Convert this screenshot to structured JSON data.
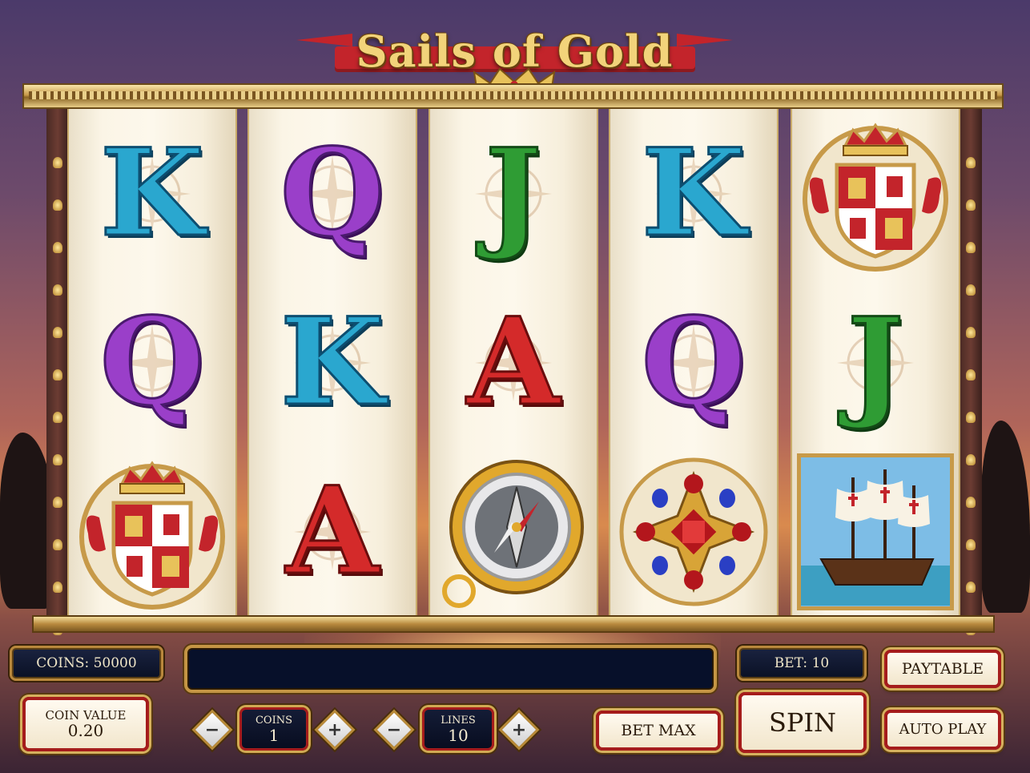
{
  "game": {
    "title": "Sails of Gold"
  },
  "reels": [
    [
      "K",
      "Q",
      "crest"
    ],
    [
      "Q",
      "K",
      "A"
    ],
    [
      "J",
      "A",
      "compass"
    ],
    [
      "K",
      "Q",
      "jewel"
    ],
    [
      "crest",
      "J",
      "ship"
    ]
  ],
  "symbols": {
    "crest": "coat-of-arms-icon",
    "compass": "pocket-compass-icon",
    "jewel": "ruby-jewel-icon",
    "ship": "galleon-ship-icon"
  },
  "panel": {
    "coins_label": "COINS: 50000",
    "message": "",
    "bet_label": "BET: 10",
    "paytable_label": "PAYTABLE",
    "coin_value_label": "COIN VALUE",
    "coin_value": "0.20",
    "coins_stepper_label": "COINS",
    "coins_value": "1",
    "lines_label": "LINES",
    "lines_value": "10",
    "minus": "−",
    "plus": "+",
    "bet_max_label": "BET MAX",
    "spin_label": "SPIN",
    "auto_play_label": "AUTO PLAY"
  },
  "colors": {
    "K": "#2aa7cf",
    "Q": "#9a3fc9",
    "J": "#2f9c34",
    "A": "#d42a2a",
    "button_border": "#a51c1c",
    "gold": "#c49544"
  }
}
